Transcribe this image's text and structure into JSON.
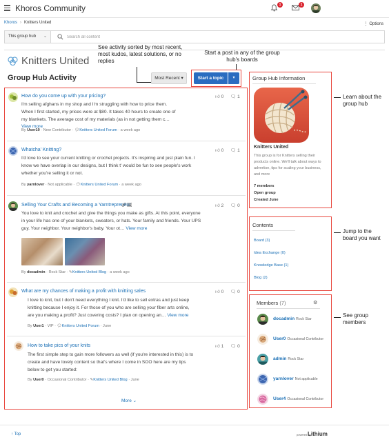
{
  "app": {
    "title": "Khoros Community",
    "notifications_count": "1",
    "messages_count": "1"
  },
  "breadcrumb": {
    "root": "Khoros",
    "current": "Knitters United"
  },
  "options_label": "Options",
  "search": {
    "scope": "This group hub",
    "placeholder": "Search all content"
  },
  "group": {
    "name": "Knitters United",
    "activity_title": "Group Hub Activity"
  },
  "toolbar": {
    "sort_label": "Most Recent",
    "start_label": "Start a topic"
  },
  "callouts": {
    "sort": "See activity sorted by most recent, most kudos, latest solutions, or no replies",
    "start": "Start a post in any of the group hub's boards",
    "info": "Learn about the group hub",
    "content": "Jump to the board you want",
    "members": "See group members"
  },
  "posts": [
    {
      "title": "How do you come up with your pricing?",
      "body": "I'm selling afghans in my shop and I'm struggling with how to price them. When I first started, my prices were at $80. It takes 40 hours to create one of my blankets.  The average cost of my materials (as in not getting them c…",
      "more": "View more",
      "by": "By",
      "author": "User10",
      "rank": "New Contributor",
      "board": "Knitters United Forum",
      "time": "a week ago",
      "kudos": "0",
      "replies": "1"
    },
    {
      "title": "Whatcha' Knitting?",
      "body": "I'd love to see your current knitting or crochet projects. It's inspiring and just plain fun. I know we have overlap in our designs, but I think t' would be fun to see people's work whether you're selling it or not.",
      "by": "By",
      "author": "yarnlover",
      "rank": "Not applicable",
      "board": "Knitters United Forum",
      "time": "a week ago",
      "kudos": "0",
      "replies": "1"
    },
    {
      "title": "Selling Your Crafts and Becoming a Yarntrepreneur",
      "body": "You love to knit and crochet and give the things you make as gifts. At this point, everyone in your life has one of your blankets, sweaters, or hats. Your family and friends. Your UPS guy. Your neighbor. Your neighbor's baby. Your ot…",
      "more": "View more",
      "by": "By",
      "author": "docadmin",
      "rank": "Rock Star",
      "board": "Knitters United Blog",
      "time": "a week ago",
      "kudos": "2",
      "replies": "0"
    },
    {
      "title": "What are my chances of making a profit with knitting sales",
      "body": "I love to knit, but I don't need everything I knit. I'd like to sell extras and just keep knitting because I enjoy it. For those of you who are selling your fiber arts online, are you making a profit? Just covering costs?  I plan on opening an…",
      "more": "View more",
      "by": "By",
      "author": "User1",
      "rank": "VIP",
      "board": "Knitters United Forum",
      "time": "June",
      "kudos": "0",
      "replies": "0"
    },
    {
      "title": "How to take pics of your knits",
      "body": "The first simple step to gain more followers as well (if you're interested in this) is to create and have lovely content so that's where I come in SOO here are my tips below to get you started:",
      "by": "By",
      "author": "User0",
      "rank": "Occasional Contributor",
      "board": "Knitters United Blog",
      "time": "June",
      "kudos": "1",
      "replies": "0"
    }
  ],
  "more_label": "More",
  "sidebar": {
    "info_title": "Group Hub Information",
    "info_name": "Knitters United",
    "info_desc": "This group is for Knitters selling their products online. We'll talk about ways to advertise, tips for scaling your business, and more",
    "members_count_label": "7 members",
    "group_type": "Open group",
    "created": "Created June",
    "content_title": "Contents",
    "content_links": [
      "Board (3)",
      "Idea Exchange (0)",
      "Knowledge Base (1)",
      "Blog (2)"
    ],
    "members_title": "Members",
    "members_count": "(7)",
    "members": [
      {
        "name": "docadmin",
        "rank": "Rock Star"
      },
      {
        "name": "User0",
        "rank": "Occasional Contributor"
      },
      {
        "name": "admin",
        "rank": "Rock Star"
      },
      {
        "name": "yarnlover",
        "rank": "Not applicable"
      },
      {
        "name": "User4",
        "rank": "Occasional Contributor"
      }
    ]
  },
  "footer": {
    "top_label": "Top",
    "powered_by": "powered by",
    "brand": "Lithium"
  },
  "colors": {
    "link": "#1a6fb5",
    "primary_button": "#2a6cc0",
    "annotation": "#e8453c",
    "badge": "#d9232e"
  }
}
